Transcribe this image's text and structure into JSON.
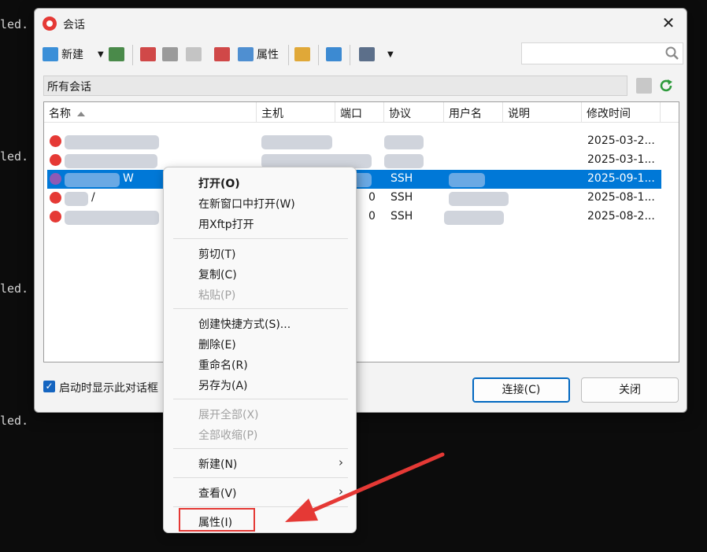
{
  "terminal": {
    "fragment": "led."
  },
  "dialog": {
    "title": "会话",
    "close_label": "✕",
    "toolbar": {
      "new_label": "新建",
      "properties_label": "属性"
    },
    "path": "所有会话",
    "columns": [
      "名称",
      "主机",
      "端口",
      "协议",
      "用户名",
      "说明",
      "修改时间"
    ],
    "rows": [
      {
        "name": "",
        "host": "",
        "port": "",
        "protocol": "",
        "user": "",
        "note": "",
        "modified": "2025-03-2..."
      },
      {
        "name": "",
        "host": "",
        "port": "",
        "protocol": "",
        "user": "",
        "note": "",
        "modified": "2025-03-1..."
      },
      {
        "name": "W",
        "host": "",
        "port": "",
        "protocol": "SSH",
        "user": "",
        "note": "",
        "modified": "2025-09-1..."
      },
      {
        "name": "/",
        "host": "",
        "port": "0",
        "protocol": "SSH",
        "user": "",
        "note": "",
        "modified": "2025-08-1..."
      },
      {
        "name": "",
        "host": "",
        "port": "0",
        "protocol": "SSH",
        "user": "",
        "note": "",
        "modified": "2025-08-2..."
      }
    ],
    "checkbox_label": "启动时显示此对话框",
    "connect_label": "连接(C)",
    "close_button_label": "关闭"
  },
  "context_menu": {
    "open": "打开(O)",
    "open_new_window": "在新窗口中打开(W)",
    "open_xftp": "用Xftp打开",
    "cut": "剪切(T)",
    "copy": "复制(C)",
    "paste": "粘贴(P)",
    "create_shortcut": "创建快捷方式(S)...",
    "delete": "删除(E)",
    "rename": "重命名(R)",
    "save_as": "另存为(A)",
    "expand_all": "展开全部(X)",
    "collapse_all": "全部收缩(P)",
    "new": "新建(N)",
    "view": "查看(V)",
    "properties": "属性(I)"
  },
  "colors": {
    "selection": "#0078d7",
    "annotation": "#e53935"
  }
}
